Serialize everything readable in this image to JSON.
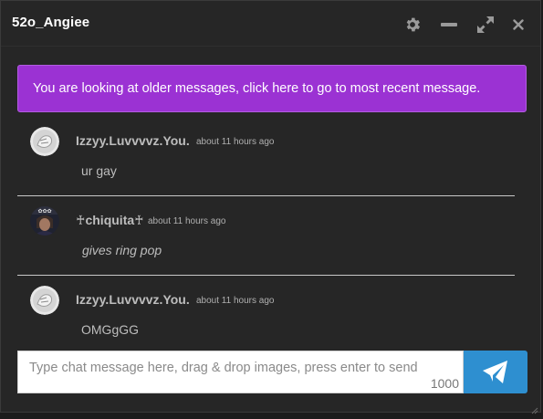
{
  "window": {
    "title": "52o_Angiee"
  },
  "titlebar": {
    "icons": [
      "gear-icon",
      "minimize-icon",
      "expand-icon",
      "close-icon"
    ]
  },
  "banner": {
    "text": "You are looking at older messages, click here to go to most recent message."
  },
  "messages": [
    {
      "username": "Izzyy.Luvvvvz.You.",
      "time": "about 11 hours ago",
      "text": "ur gay"
    },
    {
      "username": "♰chiquita♰",
      "time": "about 11 hours ago",
      "text": "gives ring pop"
    },
    {
      "username": "Izzyy.Luvvvvz.You.",
      "time": "about 11 hours ago",
      "text": "OMGgGG"
    }
  ],
  "composer": {
    "placeholder": "Type chat message here, drag & drop images, press enter to send",
    "value": "",
    "remaining": "1000"
  },
  "colors": {
    "banner": "#9b32d3",
    "send_button": "#2e8fd0",
    "window_bg": "#262626"
  }
}
